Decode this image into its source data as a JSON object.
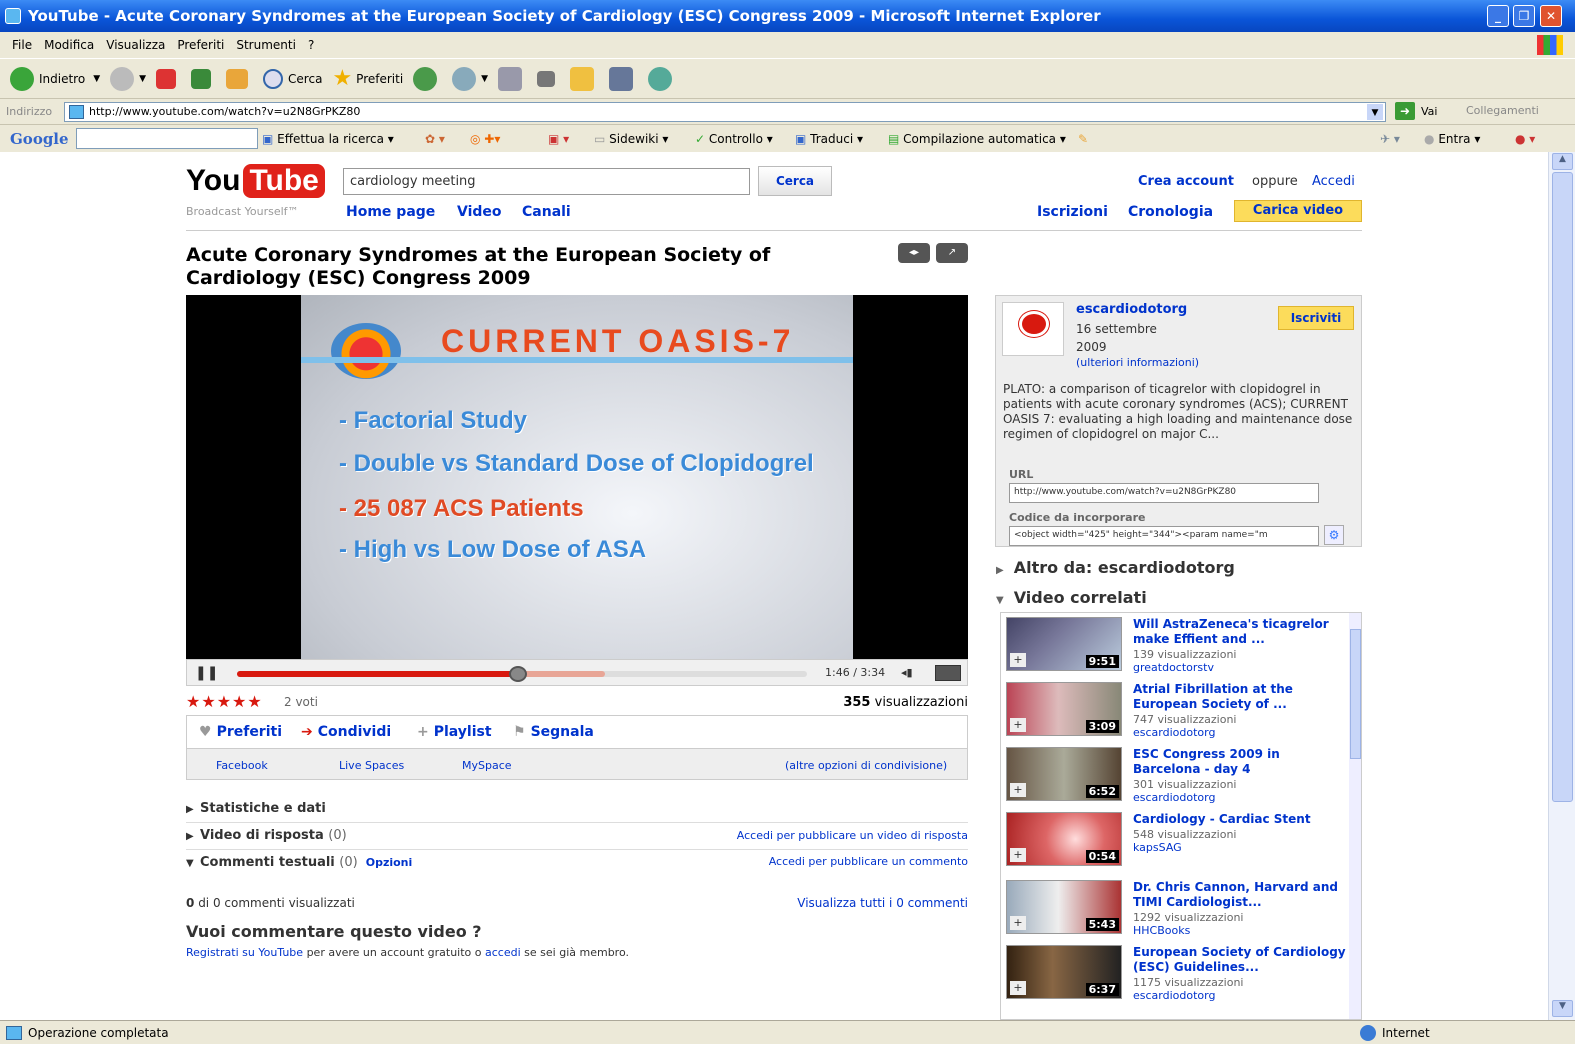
{
  "window": {
    "title": "YouTube - Acute Coronary Syndromes at the European Society of Cardiology (ESC) Congress 2009 - Microsoft Internet Explorer"
  },
  "menu": [
    "File",
    "Modifica",
    "Visualizza",
    "Preferiti",
    "Strumenti",
    "?"
  ],
  "toolbar": {
    "back": "Indietro",
    "search": "Cerca",
    "favorites": "Preferiti"
  },
  "address": {
    "label": "Indirizzo",
    "url": "http://www.youtube.com/watch?v=u2N8GrPKZ80",
    "go": "Vai",
    "links": "Collegamenti"
  },
  "googlebar": {
    "logo": "Google",
    "search_btn": "Effettua la ricerca",
    "sidewiki": "Sidewiki",
    "check": "Controllo",
    "translate": "Traduci",
    "autofill": "Compilazione automatica",
    "signin": "Entra"
  },
  "yt": {
    "logo_you": "You",
    "logo_tube": "Tube",
    "tagline": "Broadcast Yourself™",
    "search_value": "cardiology meeting",
    "search_btn": "Cerca",
    "nav": [
      "Home page",
      "Video",
      "Canali"
    ],
    "create_account": "Crea account",
    "or": "oppure",
    "signin": "Accedi",
    "subscriptions": "Iscrizioni",
    "history": "Cronologia",
    "upload": "Carica video"
  },
  "video": {
    "title": "Acute Coronary Syndromes at the European Society of Cardiology (ESC) Congress 2009",
    "slide_title": "CURRENT OASIS-7",
    "bullets": [
      "- Factorial Study",
      "- Double vs Standard Dose of Clopidogrel",
      "- 25 087 ACS Patients",
      "- High vs Low Dose of ASA"
    ],
    "time": "1:46 / 3:34",
    "progress_fraction": 0.495,
    "loaded_fraction": 0.645,
    "stars": "★★★★★",
    "votes": "2 voti",
    "views_num": "355",
    "views_label": "visualizzazioni"
  },
  "actions": {
    "favorites": "Preferiti",
    "share": "Condividi",
    "playlist": "Playlist",
    "flag": "Segnala"
  },
  "share": {
    "facebook": "Facebook",
    "live": "Live Spaces",
    "myspace": "MySpace",
    "more": "(altre opzioni di condivisione)"
  },
  "sections": {
    "stats": "Statistiche e dati",
    "responses": "Video di risposta",
    "responses_count": "(0)",
    "responses_link": "Accedi per pubblicare un video di risposta",
    "comments": "Commenti testuali",
    "comments_count": "(0)",
    "options": "Opzioni",
    "comments_link": "Accedi per pubblicare un commento"
  },
  "comments": {
    "count_bold": "0",
    "count_text": "di 0 commenti visualizzati",
    "view_all": "Visualizza tutti i 0 commenti",
    "heading": "Vuoi commentare questo video ?",
    "register": "Registrati su YouTube",
    "text_mid": "per avere un account gratuito o",
    "signin": "accedi",
    "text_end": "se sei già membro."
  },
  "channel": {
    "name": "escardiodotorg",
    "date_line1": "16 settembre",
    "date_line2": "2009",
    "more": "(ulteriori informazioni)",
    "subscribe": "Iscriviti",
    "description": "PLATO: a comparison of ticagrelor with clopidogrel in patients with acute coronary syndromes (ACS); CURRENT OASIS 7: evaluating a high loading and maintenance dose regimen of clopidogrel on major C...",
    "url_label": "URL",
    "url_value": "http://www.youtube.com/watch?v=u2N8GrPKZ80",
    "embed_label": "Codice da incorporare",
    "embed_value": "<object width=\"425\" height=\"344\"><param name=\"m"
  },
  "sidebar": {
    "more_from": "Altro da: escardiodotorg",
    "related": "Video correlati"
  },
  "related": [
    {
      "title": "Will AstraZeneca's ticagrelor make Effient and ...",
      "views": "139 visualizzazioni",
      "channel": "greatdoctorstv",
      "duration": "9:51"
    },
    {
      "title": "Atrial Fibrillation at the European Society of ...",
      "views": "747 visualizzazioni",
      "channel": "escardiodotorg",
      "duration": "3:09"
    },
    {
      "title": "ESC Congress 2009 in Barcelona - day 4",
      "views": "301 visualizzazioni",
      "channel": "escardiodotorg",
      "duration": "6:52"
    },
    {
      "title": "Cardiology - Cardiac Stent",
      "views": "548 visualizzazioni",
      "channel": "kapsSAG",
      "duration": "0:54"
    },
    {
      "title": "Dr. Chris Cannon, Harvard and TIMI Cardiologist...",
      "views": "1292 visualizzazioni",
      "channel": "HHCBooks",
      "duration": "5:43"
    },
    {
      "title": "European Society of Cardiology (ESC) Guidelines...",
      "views": "1175 visualizzazioni",
      "channel": "escardiodotorg",
      "duration": "6:37"
    }
  ],
  "status": {
    "text": "Operazione completata",
    "zone": "Internet"
  }
}
